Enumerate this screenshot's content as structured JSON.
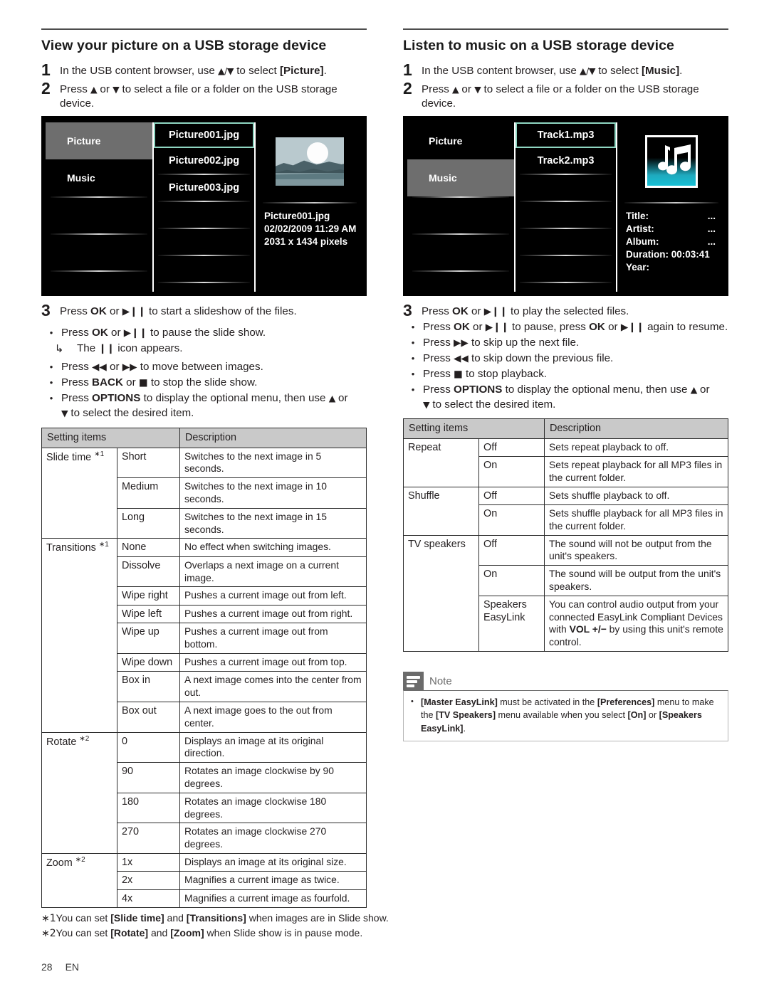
{
  "footer": {
    "page_number": "28",
    "language": "EN"
  },
  "left": {
    "title": "View your picture on a USB storage device",
    "steps": [
      {
        "num": "1",
        "text_pre": "In the USB content browser, use ",
        "glyphs": "▲/▼",
        "text_mid": " to select ",
        "keyword": "[Picture]",
        "text_post": "."
      },
      {
        "num": "2",
        "text_pre": "Press ",
        "glyphs": "▲",
        "text_mid": " or ",
        "glyphs2": "▼",
        "text_post": " to select a file or a folder on the USB storage device."
      }
    ],
    "tv": {
      "sidebar": [
        {
          "label": "Picture",
          "selected": true
        },
        {
          "label": "Music",
          "selected": false
        }
      ],
      "files": [
        {
          "label": "Picture001.jpg",
          "selected": true
        },
        {
          "label": "Picture002.jpg",
          "selected": false
        },
        {
          "label": "Picture003.jpg",
          "selected": false
        }
      ],
      "thumbnail": "picture-landscape-thumbnail",
      "meta": [
        {
          "label": "Picture001.jpg"
        },
        {
          "label": "02/02/2009 11:29 AM"
        },
        {
          "label": "2031 x 1434 pixels"
        }
      ]
    },
    "step3": {
      "num": "3",
      "pre": "Press ",
      "ok": "OK",
      "mid": " or ",
      "playpause": "▶❙❙",
      "post": " to start a slideshow of the files."
    },
    "bullets": [
      {
        "parts": [
          "Press ",
          "OK",
          " or ",
          "▶❙❙",
          " to pause the slide show."
        ]
      },
      {
        "arrow": true,
        "pre": "The ",
        "glyph": "❙❙",
        "post": " icon appears."
      },
      {
        "parts": [
          "Press ",
          "◀◀",
          " or ",
          "▶▶",
          " to move between images."
        ]
      },
      {
        "parts": [
          "Press ",
          "BACK",
          " or ",
          "■",
          " to stop the slide show."
        ]
      },
      {
        "parts": [
          "Press ",
          "OPTIONS",
          " to display the optional menu, then use ",
          "▲",
          " or"
        ]
      },
      {
        "cont": true,
        "parts": [
          "▼",
          " to select the desired item."
        ]
      }
    ],
    "table": {
      "headers": [
        "Setting items",
        "Description"
      ],
      "groups": [
        {
          "item": "Slide time",
          "footnote": "∗1",
          "rows": [
            {
              "value": "Short",
              "desc": "Switches to the next image in 5 seconds."
            },
            {
              "value": "Medium",
              "desc": "Switches to the next image in 10 seconds."
            },
            {
              "value": "Long",
              "desc": "Switches to the next image in 15 seconds."
            }
          ]
        },
        {
          "item": "Transitions",
          "footnote": "∗1",
          "rows": [
            {
              "value": "None",
              "desc": "No effect when switching images."
            },
            {
              "value": "Dissolve",
              "desc": "Overlaps a next image on a current image."
            },
            {
              "value": "Wipe right",
              "desc": "Pushes a current image out from left."
            },
            {
              "value": "Wipe left",
              "desc": "Pushes a current image out from right."
            },
            {
              "value": "Wipe up",
              "desc": "Pushes a current image out from bottom."
            },
            {
              "value": "Wipe down",
              "desc": "Pushes a current image out from top."
            },
            {
              "value": "Box in",
              "desc": "A next image comes into the center from out."
            },
            {
              "value": "Box out",
              "desc": "A next image goes to the out from center."
            }
          ]
        },
        {
          "item": "Rotate",
          "footnote": "∗2",
          "rows": [
            {
              "value": "0",
              "desc": "Displays an image at its original direction."
            },
            {
              "value": "90",
              "desc": "Rotates an image clockwise by 90 degrees."
            },
            {
              "value": "180",
              "desc": "Rotates an image clockwise 180 degrees."
            },
            {
              "value": "270",
              "desc": "Rotates an image clockwise 270 degrees."
            }
          ]
        },
        {
          "item": "Zoom",
          "footnote": "∗2",
          "rows": [
            {
              "value": "1x",
              "desc": "Displays an image at its original size."
            },
            {
              "value": "2x",
              "desc": "Magnifies a current image as twice."
            },
            {
              "value": "4x",
              "desc": "Magnifies a current image as fourfold."
            }
          ]
        }
      ]
    },
    "footnotes": [
      {
        "mark": "∗1",
        "pre": "You can set ",
        "kw1": "[Slide time]",
        "mid": " and ",
        "kw2": "[Transitions]",
        "post": " when images are in Slide show."
      },
      {
        "mark": "∗2",
        "pre": "You can set ",
        "kw1": "[Rotate]",
        "mid": " and ",
        "kw2": "[Zoom]",
        "post": " when Slide show is in pause mode."
      }
    ]
  },
  "right": {
    "title": "Listen to music on a USB storage device",
    "steps": [
      {
        "num": "1",
        "text_pre": "In the USB content browser, use ",
        "glyphs": "▲/▼",
        "text_mid": " to select ",
        "keyword": "[Music]",
        "text_post": "."
      },
      {
        "num": "2",
        "text_pre": "Press ",
        "glyphs": "▲",
        "text_mid": " or ",
        "glyphs2": "▼",
        "text_post": " to select a file or a folder on the USB storage device."
      }
    ],
    "tv": {
      "sidebar": [
        {
          "label": "Picture",
          "selected": false
        },
        {
          "label": "Music",
          "selected": true
        }
      ],
      "files": [
        {
          "label": "Track1.mp3",
          "selected": true
        },
        {
          "label": "Track2.mp3",
          "selected": false
        }
      ],
      "thumbnail": "music-note-thumbnail",
      "meta": [
        {
          "label": "Title:",
          "value": "..."
        },
        {
          "label": "Artist:",
          "value": "..."
        },
        {
          "label": "Album:",
          "value": "..."
        },
        {
          "label": "Duration: 00:03:41",
          "value": ""
        },
        {
          "label": "Year:",
          "value": ""
        }
      ]
    },
    "step3": {
      "num": "3",
      "pre": "Press ",
      "ok": "OK",
      "mid": " or ",
      "playpause": "▶❙❙",
      "post": " to play the selected files."
    },
    "bullets": [
      {
        "parts": [
          "Press ",
          "OK",
          " or ",
          "▶❙❙",
          " to pause, press ",
          "OK",
          " or ",
          "▶❙❙",
          " again to resume."
        ]
      },
      {
        "parts": [
          "Press ",
          "▶▶",
          " to skip up the next file."
        ]
      },
      {
        "parts": [
          "Press ",
          "◀◀",
          " to skip down the previous file."
        ]
      },
      {
        "parts": [
          "Press ",
          "■",
          " to stop playback."
        ]
      },
      {
        "parts": [
          "Press ",
          "OPTIONS",
          " to display the optional menu, then use ",
          "▲",
          " or"
        ]
      },
      {
        "cont": true,
        "parts": [
          "▼",
          " to select the desired item."
        ]
      }
    ],
    "table": {
      "headers": [
        "Setting items",
        "Description"
      ],
      "groups": [
        {
          "item": "Repeat",
          "rows": [
            {
              "value": "Off",
              "desc": "Sets repeat playback to off."
            },
            {
              "value": "On",
              "desc": "Sets repeat playback for all MP3 files in the current folder."
            }
          ]
        },
        {
          "item": "Shuffle",
          "rows": [
            {
              "value": "Off",
              "desc": "Sets shuffle playback to off."
            },
            {
              "value": "On",
              "desc": "Sets shuffle playback for all MP3 files in the current folder."
            }
          ]
        },
        {
          "item": "TV speakers",
          "rows": [
            {
              "value": "Off",
              "desc": "The sound will not be output from the unit's speakers."
            },
            {
              "value": "On",
              "desc": "The sound will be output from the unit's speakers."
            },
            {
              "value": "Speakers EasyLink",
              "desc_pre": "You can control audio output from your connected EasyLink Compliant Devices with ",
              "desc_kw": "VOL +/−",
              "desc_post": " by using this unit's remote control."
            }
          ]
        }
      ]
    },
    "note": {
      "title": "Note",
      "items": [
        {
          "kw1": "[Master EasyLink]",
          "t1": " must be activated in the ",
          "kw2": "[Preferences]",
          "t2": " menu to make the ",
          "kw3": "[TV Speakers]",
          "t3": " menu available when you select ",
          "kw4": "[On]",
          "t4": " or ",
          "kw5": "[Speakers EasyLink]",
          "t5": "."
        }
      ]
    }
  }
}
